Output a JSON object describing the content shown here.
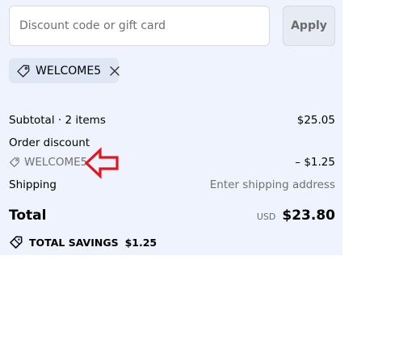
{
  "discount": {
    "placeholder": "Discount code or gift card",
    "apply_label": "Apply",
    "applied_code": "WELCOME5"
  },
  "summary": {
    "subtotal_label": "Subtotal · 2 items",
    "subtotal_value": "$25.05",
    "order_discount_label": "Order discount",
    "discount_code": "WELCOME5",
    "discount_value": "– $1.25",
    "shipping_label": "Shipping",
    "shipping_value": "Enter shipping address"
  },
  "total": {
    "label": "Total",
    "currency": "USD",
    "amount": "$23.80"
  },
  "savings": {
    "label": "TOTAL SAVINGS",
    "amount": "$1.25"
  },
  "icons": {
    "tag": "tag-icon",
    "close": "close-icon",
    "savings_tag": "tag-icon",
    "annotation": "left-arrow-icon"
  },
  "colors": {
    "panel_bg": "#eef3fd",
    "chip_bg": "#dfe6f5",
    "muted_text": "#707070",
    "annotation": "#e3141c"
  }
}
